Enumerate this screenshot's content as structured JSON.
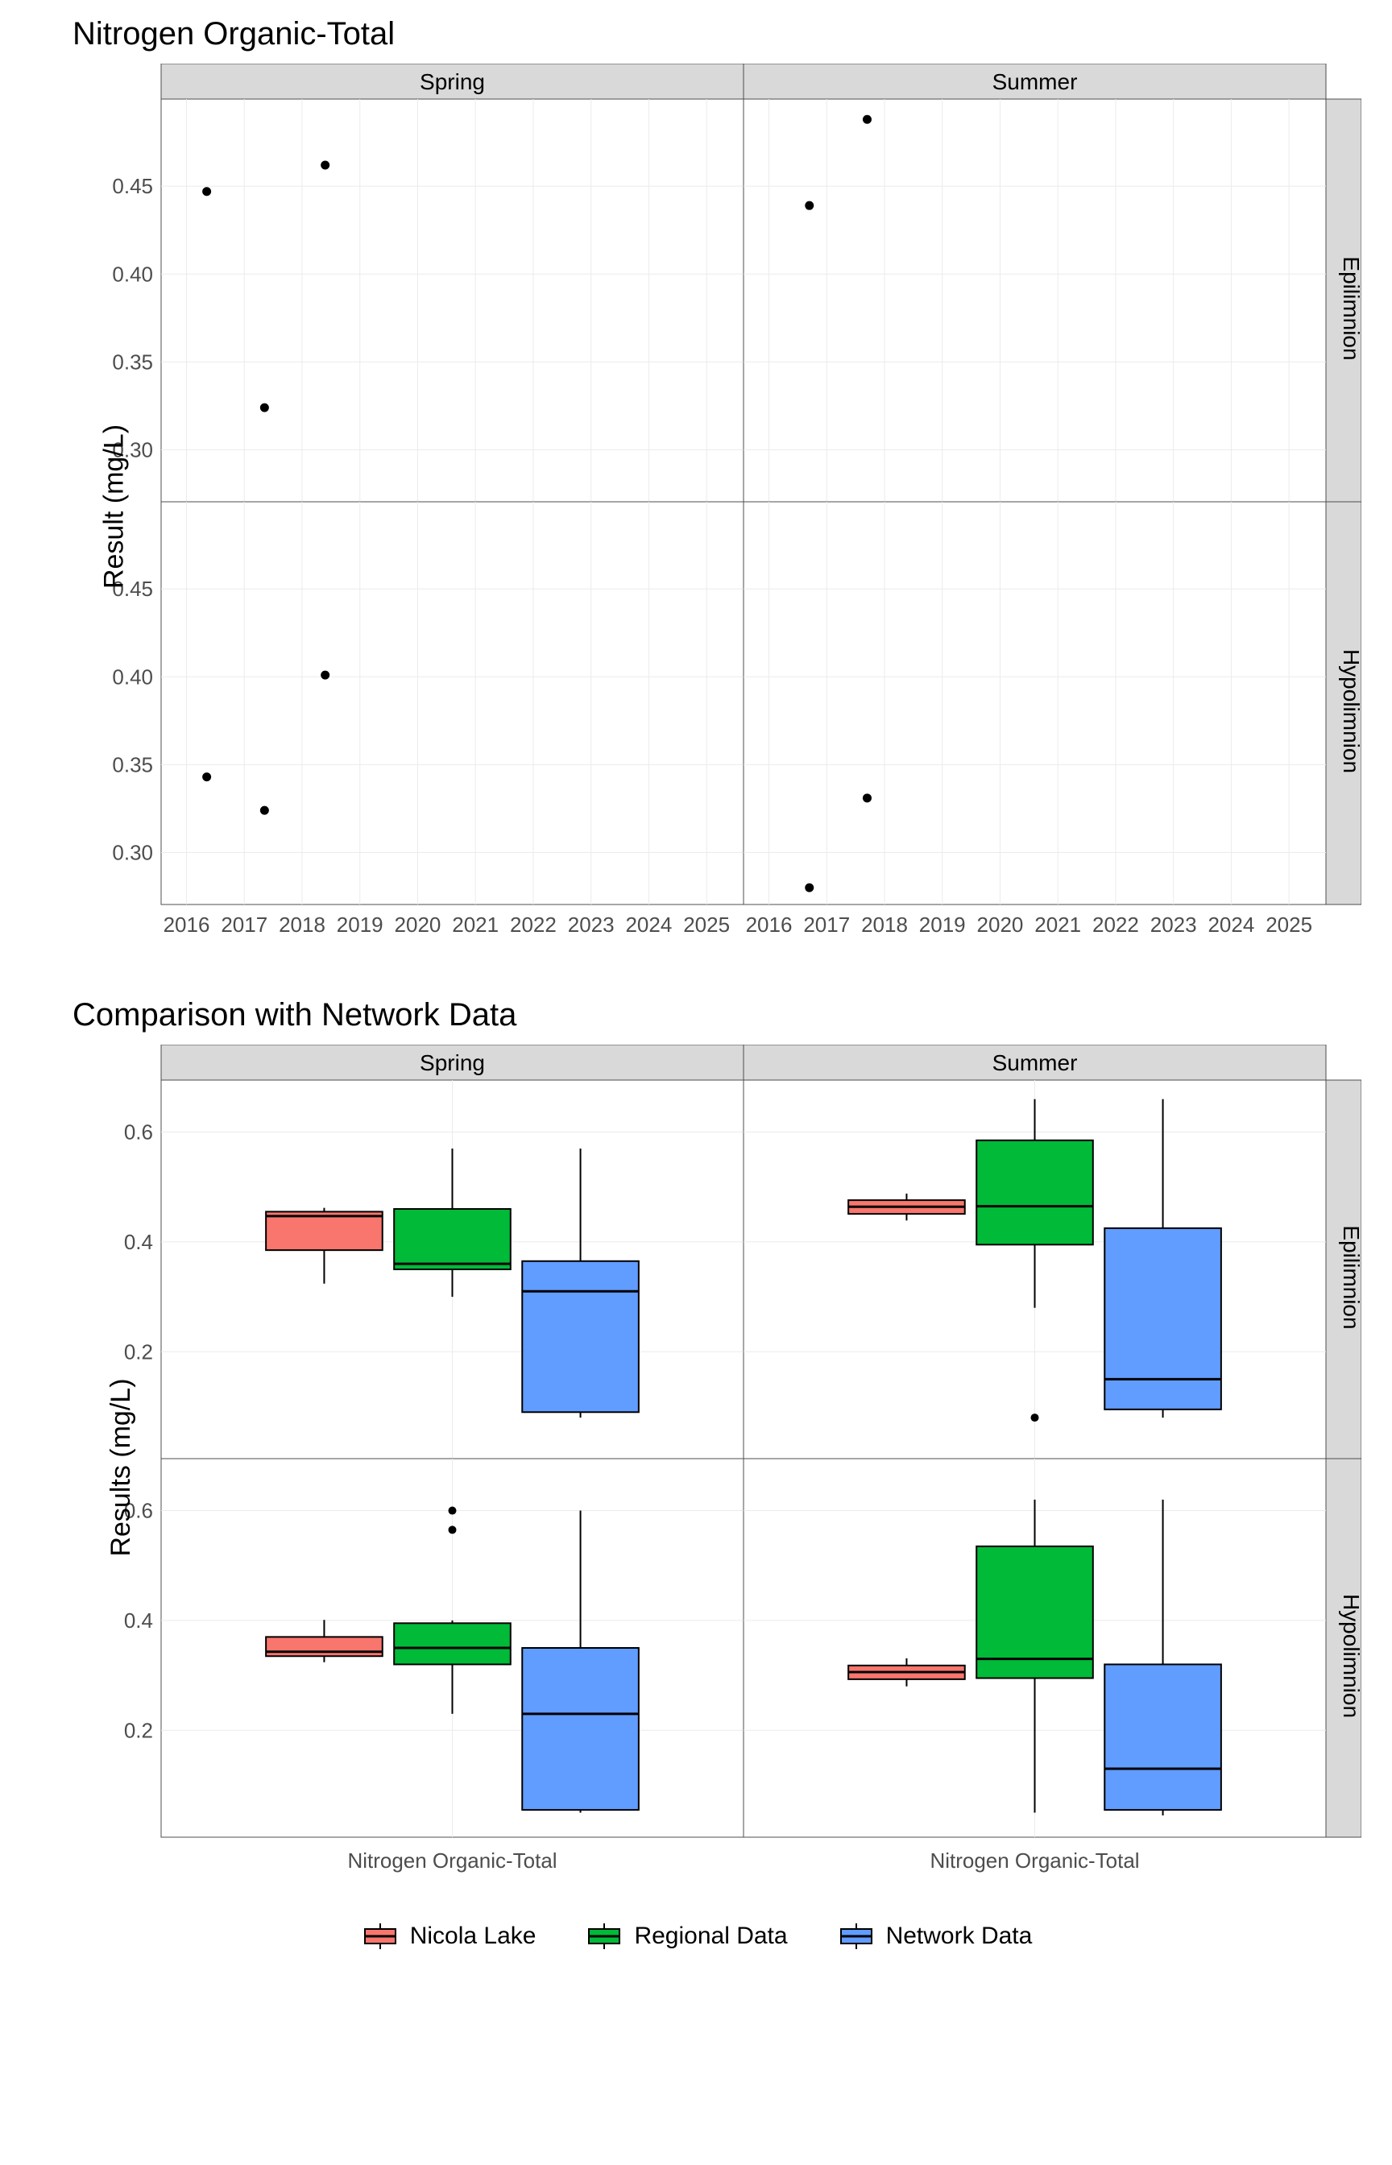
{
  "chart_data": [
    {
      "id": "scatter",
      "type": "scatter",
      "title": "Nitrogen Organic-Total",
      "ylabel": "Result (mg/L)",
      "col_facets": [
        "Spring",
        "Summer"
      ],
      "row_facets": [
        "Epilimnion",
        "Hypolimnion"
      ],
      "x_ticks": [
        2016,
        2017,
        2018,
        2019,
        2020,
        2021,
        2022,
        2023,
        2024,
        2025
      ],
      "y_ticks": [
        0.3,
        0.35,
        0.4,
        0.45
      ],
      "xlim": [
        2015.7,
        2025.5
      ],
      "ylim": [
        0.275,
        0.495
      ],
      "panels": {
        "Spring|Epilimnion": [
          [
            2016.35,
            0.447
          ],
          [
            2017.35,
            0.324
          ],
          [
            2018.4,
            0.462
          ]
        ],
        "Summer|Epilimnion": [
          [
            2016.7,
            0.439
          ],
          [
            2017.7,
            0.488
          ]
        ],
        "Spring|Hypolimnion": [
          [
            2016.35,
            0.343
          ],
          [
            2017.35,
            0.324
          ],
          [
            2018.4,
            0.401
          ]
        ],
        "Summer|Hypolimnion": [
          [
            2016.7,
            0.28
          ],
          [
            2017.7,
            0.331
          ]
        ]
      }
    },
    {
      "id": "box",
      "type": "box",
      "title": "Comparison with Network Data",
      "ylabel": "Results (mg/L)",
      "xlabel_each": "Nitrogen Organic-Total",
      "col_facets": [
        "Spring",
        "Summer"
      ],
      "row_facets": [
        "Epilimnion",
        "Hypolimnion"
      ],
      "groups": [
        "Nicola Lake",
        "Regional Data",
        "Network Data"
      ],
      "colors": {
        "Nicola Lake": "#F8766D",
        "Regional Data": "#00BA38",
        "Network Data": "#619CFF"
      },
      "y_ticks": [
        0.2,
        0.4,
        0.6
      ],
      "ylim": [
        0.02,
        0.68
      ],
      "panels": {
        "Spring|Epilimnion": {
          "Nicola Lake": {
            "min": 0.324,
            "q1": 0.385,
            "med": 0.447,
            "q3": 0.455,
            "max": 0.462,
            "out": []
          },
          "Regional Data": {
            "min": 0.3,
            "q1": 0.35,
            "med": 0.36,
            "q3": 0.46,
            "max": 0.57,
            "out": []
          },
          "Network Data": {
            "min": 0.08,
            "q1": 0.09,
            "med": 0.31,
            "q3": 0.365,
            "max": 0.57,
            "out": []
          }
        },
        "Summer|Epilimnion": {
          "Nicola Lake": {
            "min": 0.439,
            "q1": 0.451,
            "med": 0.464,
            "q3": 0.476,
            "max": 0.488,
            "out": []
          },
          "Regional Data": {
            "min": 0.28,
            "q1": 0.395,
            "med": 0.465,
            "q3": 0.585,
            "max": 0.66,
            "out": [
              0.08
            ]
          },
          "Network Data": {
            "min": 0.08,
            "q1": 0.095,
            "med": 0.15,
            "q3": 0.425,
            "max": 0.66,
            "out": []
          }
        },
        "Spring|Hypolimnion": {
          "Nicola Lake": {
            "min": 0.324,
            "q1": 0.335,
            "med": 0.343,
            "q3": 0.37,
            "max": 0.401,
            "out": []
          },
          "Regional Data": {
            "min": 0.23,
            "q1": 0.32,
            "med": 0.35,
            "q3": 0.395,
            "max": 0.4,
            "out": [
              0.565,
              0.6
            ]
          },
          "Network Data": {
            "min": 0.05,
            "q1": 0.055,
            "med": 0.23,
            "q3": 0.35,
            "max": 0.6,
            "out": []
          }
        },
        "Summer|Hypolimnion": {
          "Nicola Lake": {
            "min": 0.28,
            "q1": 0.293,
            "med": 0.306,
            "q3": 0.318,
            "max": 0.331,
            "out": []
          },
          "Regional Data": {
            "min": 0.05,
            "q1": 0.295,
            "med": 0.33,
            "q3": 0.535,
            "max": 0.62,
            "out": []
          },
          "Network Data": {
            "min": 0.045,
            "q1": 0.055,
            "med": 0.13,
            "q3": 0.32,
            "max": 0.62,
            "out": []
          }
        }
      }
    }
  ],
  "legend": {
    "items": [
      "Nicola Lake",
      "Regional Data",
      "Network Data"
    ],
    "colors": {
      "Nicola Lake": "#F8766D",
      "Regional Data": "#00BA38",
      "Network Data": "#619CFF"
    }
  }
}
